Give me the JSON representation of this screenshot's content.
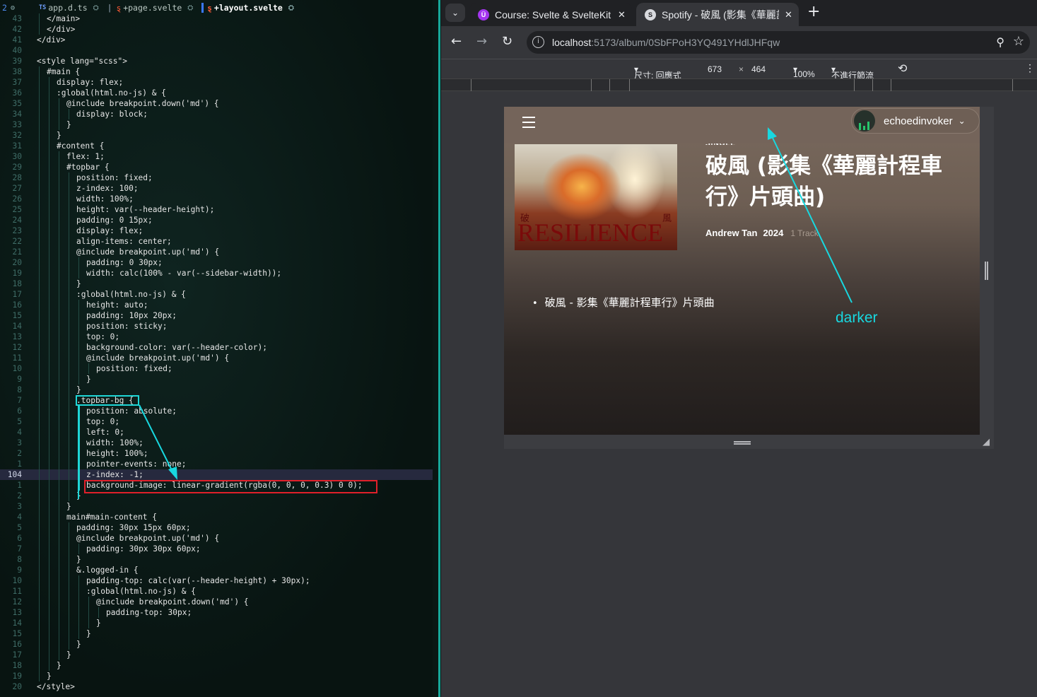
{
  "editor": {
    "tabs": [
      {
        "prefix": "TS",
        "label": "app.d.ts",
        "active": false
      },
      {
        "prefix": "svelte",
        "label": "+page.svelte",
        "active": false
      },
      {
        "prefix": "svelte",
        "label": "+layout.svelte",
        "active": true
      }
    ],
    "tab_count": "2",
    "lines": [
      {
        "n": "43",
        "indent": 1,
        "text": "</main>"
      },
      {
        "n": "42",
        "indent": 1,
        "text": "</div>"
      },
      {
        "n": "41",
        "indent": 0,
        "text": "</div>"
      },
      {
        "n": "40",
        "indent": 0,
        "text": ""
      },
      {
        "n": "39",
        "indent": 0,
        "text": "<style lang=\"scss\">"
      },
      {
        "n": "38",
        "indent": 1,
        "text": "#main {"
      },
      {
        "n": "37",
        "indent": 2,
        "text": "display: flex;"
      },
      {
        "n": "36",
        "indent": 2,
        "text": ":global(html.no-js) & {"
      },
      {
        "n": "35",
        "indent": 3,
        "text": "@include breakpoint.down('md') {"
      },
      {
        "n": "34",
        "indent": 4,
        "text": "display: block;"
      },
      {
        "n": "33",
        "indent": 3,
        "text": "}"
      },
      {
        "n": "32",
        "indent": 2,
        "text": "}"
      },
      {
        "n": "31",
        "indent": 2,
        "text": "#content {"
      },
      {
        "n": "30",
        "indent": 3,
        "text": "flex: 1;"
      },
      {
        "n": "29",
        "indent": 3,
        "text": "#topbar {"
      },
      {
        "n": "28",
        "indent": 4,
        "text": "position: fixed;"
      },
      {
        "n": "27",
        "indent": 4,
        "text": "z-index: 100;"
      },
      {
        "n": "26",
        "indent": 4,
        "text": "width: 100%;"
      },
      {
        "n": "25",
        "indent": 4,
        "text": "height: var(--header-height);"
      },
      {
        "n": "24",
        "indent": 4,
        "text": "padding: 0 15px;"
      },
      {
        "n": "23",
        "indent": 4,
        "text": "display: flex;"
      },
      {
        "n": "22",
        "indent": 4,
        "text": "align-items: center;"
      },
      {
        "n": "21",
        "indent": 4,
        "text": "@include breakpoint.up('md') {"
      },
      {
        "n": "20",
        "indent": 5,
        "text": "padding: 0 30px;"
      },
      {
        "n": "19",
        "indent": 5,
        "text": "width: calc(100% - var(--sidebar-width));"
      },
      {
        "n": "18",
        "indent": 4,
        "text": "}"
      },
      {
        "n": "17",
        "indent": 4,
        "text": ":global(html.no-js) & {"
      },
      {
        "n": "16",
        "indent": 5,
        "text": "height: auto;"
      },
      {
        "n": "15",
        "indent": 5,
        "text": "padding: 10px 20px;"
      },
      {
        "n": "14",
        "indent": 5,
        "text": "position: sticky;"
      },
      {
        "n": "13",
        "indent": 5,
        "text": "top: 0;"
      },
      {
        "n": "12",
        "indent": 5,
        "text": "background-color: var(--header-color);"
      },
      {
        "n": "11",
        "indent": 5,
        "text": "@include breakpoint.up('md') {"
      },
      {
        "n": "10",
        "indent": 6,
        "text": "position: fixed;"
      },
      {
        "n": "9",
        "indent": 5,
        "text": "}"
      },
      {
        "n": "8",
        "indent": 4,
        "text": "}"
      },
      {
        "n": "7",
        "indent": 4,
        "text": ".topbar-bg {"
      },
      {
        "n": "6",
        "indent": 5,
        "text": "position: absolute;"
      },
      {
        "n": "5",
        "indent": 5,
        "text": "top: 0;"
      },
      {
        "n": "4",
        "indent": 5,
        "text": "left: 0;"
      },
      {
        "n": "3",
        "indent": 5,
        "text": "width: 100%;"
      },
      {
        "n": "2",
        "indent": 5,
        "text": "height: 100%;"
      },
      {
        "n": "1",
        "indent": 5,
        "text": "pointer-events: none;"
      },
      {
        "n": "104",
        "indent": 5,
        "text": "z-index: -1;",
        "current": true
      },
      {
        "n": "1",
        "indent": 5,
        "text": "background-image: linear-gradient(rgba(0, 0, 0, 0.3) 0 0);"
      },
      {
        "n": "2",
        "indent": 4,
        "text": "}"
      },
      {
        "n": "3",
        "indent": 3,
        "text": "}"
      },
      {
        "n": "4",
        "indent": 3,
        "text": "main#main-content {"
      },
      {
        "n": "5",
        "indent": 4,
        "text": "padding: 30px 15px 60px;"
      },
      {
        "n": "6",
        "indent": 4,
        "text": "@include breakpoint.up('md') {"
      },
      {
        "n": "7",
        "indent": 5,
        "text": "padding: 30px 30px 60px;"
      },
      {
        "n": "8",
        "indent": 4,
        "text": "}"
      },
      {
        "n": "9",
        "indent": 4,
        "text": "&.logged-in {"
      },
      {
        "n": "10",
        "indent": 5,
        "text": "padding-top: calc(var(--header-height) + 30px);"
      },
      {
        "n": "11",
        "indent": 5,
        "text": ":global(html.no-js) & {"
      },
      {
        "n": "12",
        "indent": 6,
        "text": "@include breakpoint.down('md') {"
      },
      {
        "n": "13",
        "indent": 7,
        "text": "padding-top: 30px;"
      },
      {
        "n": "14",
        "indent": 6,
        "text": "}"
      },
      {
        "n": "15",
        "indent": 5,
        "text": "}"
      },
      {
        "n": "16",
        "indent": 4,
        "text": "}"
      },
      {
        "n": "17",
        "indent": 3,
        "text": "}"
      },
      {
        "n": "18",
        "indent": 2,
        "text": "}"
      },
      {
        "n": "19",
        "indent": 1,
        "text": "}"
      },
      {
        "n": "20",
        "indent": 0,
        "text": "</style>"
      }
    ]
  },
  "browser": {
    "tabs": [
      {
        "label": "Course: Svelte & SvelteKit",
        "icon": "udemy-icon"
      },
      {
        "label": "Spotify - 破風 (影集《華麗計程車行》片頭曲)",
        "icon": "svelte-icon"
      }
    ],
    "url_host": "localhost",
    "url_rest": ":5173/album/0SbFPoH3YQ491YHdlJHFqw",
    "devtools": {
      "dimensions_label": "尺寸: 回應式",
      "width": "673",
      "times": "×",
      "height": "464",
      "zoom": "100%",
      "throttle": "不進行節流"
    }
  },
  "page": {
    "user_name": "echoedinvoker",
    "single_label": "SINGLE",
    "album_title": "破風 (影集《華麗計程車行》片頭曲)",
    "artist": "Andrew Tan",
    "year": "2024",
    "track_count": "1 Track",
    "cover_text": "RESILIENCE",
    "cover_char_left": "破",
    "cover_char_right": "風",
    "tracks": [
      "破風 - 影集《華麗計程車行》片頭曲"
    ]
  },
  "annotations": {
    "darker_label": "darker",
    "color_cyan": "#18d8e0",
    "color_red": "#e0202a"
  }
}
